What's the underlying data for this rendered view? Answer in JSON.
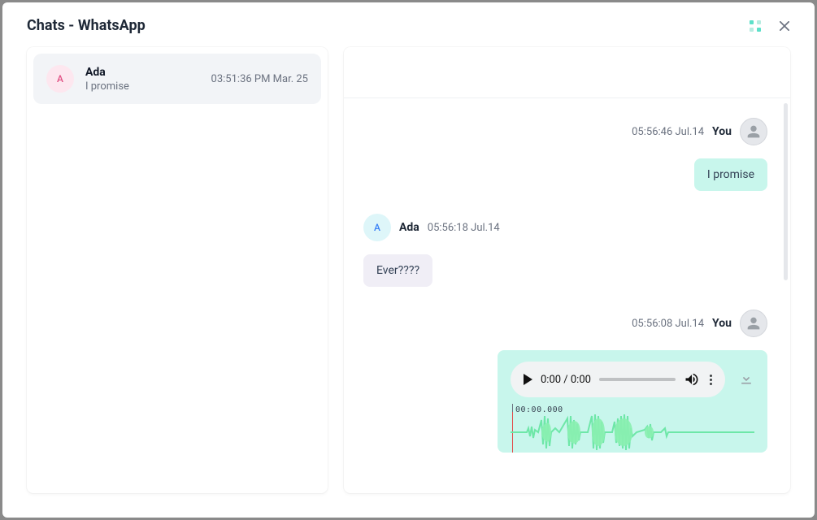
{
  "window": {
    "title": "Chats - WhatsApp"
  },
  "sidebar": {
    "items": [
      {
        "initial": "A",
        "name": "Ada",
        "preview": "I promise",
        "time": "03:51:36 PM Mar. 25"
      }
    ]
  },
  "messages": [
    {
      "side": "right",
      "author": "You",
      "time": "05:56:46 Jul.14",
      "type": "text",
      "text": "I promise"
    },
    {
      "side": "left",
      "author": "Ada",
      "initial": "A",
      "time": "05:56:18 Jul.14",
      "type": "text",
      "text": "Ever????"
    },
    {
      "side": "right",
      "author": "You",
      "time": "05:56:08 Jul.14",
      "type": "voice",
      "player_time": "0:00 / 0:00",
      "wave_time": "00:00.000"
    }
  ]
}
